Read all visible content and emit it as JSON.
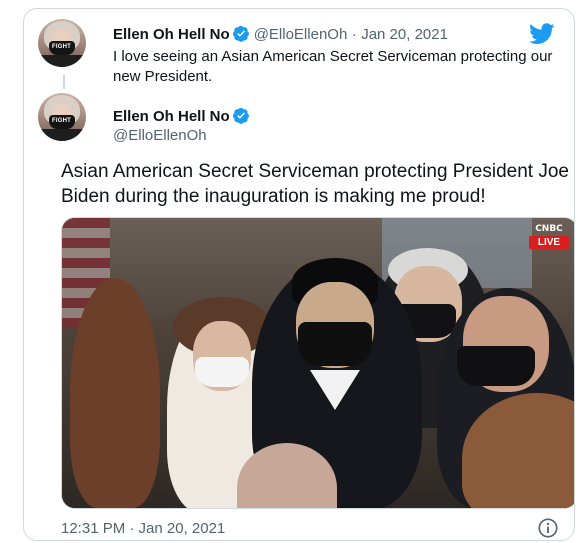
{
  "original_tweet": {
    "author_name": "Ellen Oh Hell No",
    "author_handle": "@ElloEllenOh",
    "separator": "·",
    "date": "Jan 20, 2021",
    "text": "I love seeing an Asian American Secret Serviceman protecting our new President."
  },
  "reply_tweet": {
    "author_name": "Ellen Oh Hell No",
    "author_handle": "@ElloEllenOh",
    "text": "Asian American Secret Serviceman protecting President Joe Biden during the inauguration is making me proud!",
    "timestamp": "12:31 PM · Jan 20, 2021"
  },
  "media": {
    "network_logo": "CNBC",
    "live_badge": "LIVE"
  },
  "avatar": {
    "mask_text": "FIGHT"
  },
  "icons": {
    "brand": "twitter-bird-icon",
    "verified": "verified-badge-icon",
    "info": "info-icon"
  },
  "colors": {
    "brand_blue": "#1d9bf0",
    "text_primary": "#0f1419",
    "text_secondary": "#536471",
    "border": "#cfd9de",
    "live_red": "#d81e1e"
  }
}
